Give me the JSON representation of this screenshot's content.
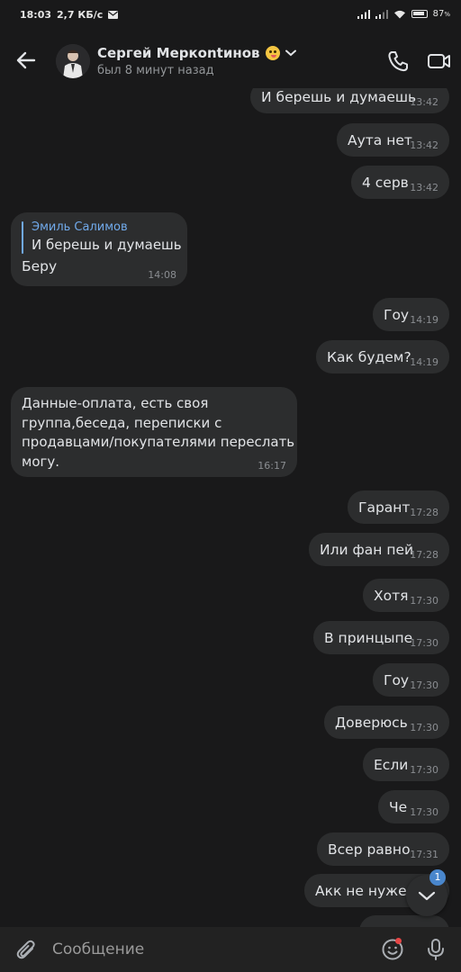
{
  "status_bar": {
    "time": "18:03",
    "speed": "2,7 КБ/с",
    "battery": "87",
    "battery_unit": "%"
  },
  "header": {
    "name": "Сергей Меркontинов",
    "last_seen": "был 8 минут назад"
  },
  "messages": [
    {
      "side": "out",
      "text": "И берешь и думаешь",
      "time": "13:42"
    },
    {
      "side": "out",
      "text": "Аута нет",
      "time": "13:42"
    },
    {
      "side": "out",
      "text": "4 серв",
      "time": "13:42"
    },
    {
      "side": "in",
      "reply_name": "Эмиль Салимов",
      "reply_text": "И берешь и думаешь",
      "text": "Беру",
      "time": "14:08"
    },
    {
      "side": "out",
      "text": "Гоу",
      "time": "14:19"
    },
    {
      "side": "out",
      "text": "Как будем?",
      "time": "14:19"
    },
    {
      "side": "in",
      "text": "Данные-оплата, есть своя\nгруппа,беседа, переписки с\nпродавцами/покупателями переслать\nмогу.",
      "time": "16:17"
    },
    {
      "side": "out",
      "text": "Гарант",
      "time": "17:28"
    },
    {
      "side": "out",
      "text": "Или фан пей",
      "time": "17:28"
    },
    {
      "side": "out",
      "text": "Хотя",
      "time": "17:30"
    },
    {
      "side": "out",
      "text": "В принцыпе",
      "time": "17:30"
    },
    {
      "side": "out",
      "text": "Гоу",
      "time": "17:30"
    },
    {
      "side": "out",
      "text": "Доверюсь",
      "time": "17:30"
    },
    {
      "side": "out",
      "text": "Если",
      "time": "17:30"
    },
    {
      "side": "out",
      "text": "Че",
      "time": "17:30"
    },
    {
      "side": "out",
      "text": "Всер равно",
      "time": "17:31"
    },
    {
      "side": "out",
      "text": "Акк не нужен",
      "time": ""
    }
  ],
  "scroll_badge": "1",
  "composer": {
    "placeholder": "Сообщение"
  },
  "colors": {
    "background": "#19191a",
    "bubble": "#2c2d2e",
    "accent": "#71aaeb",
    "badge": "#4986cc"
  }
}
